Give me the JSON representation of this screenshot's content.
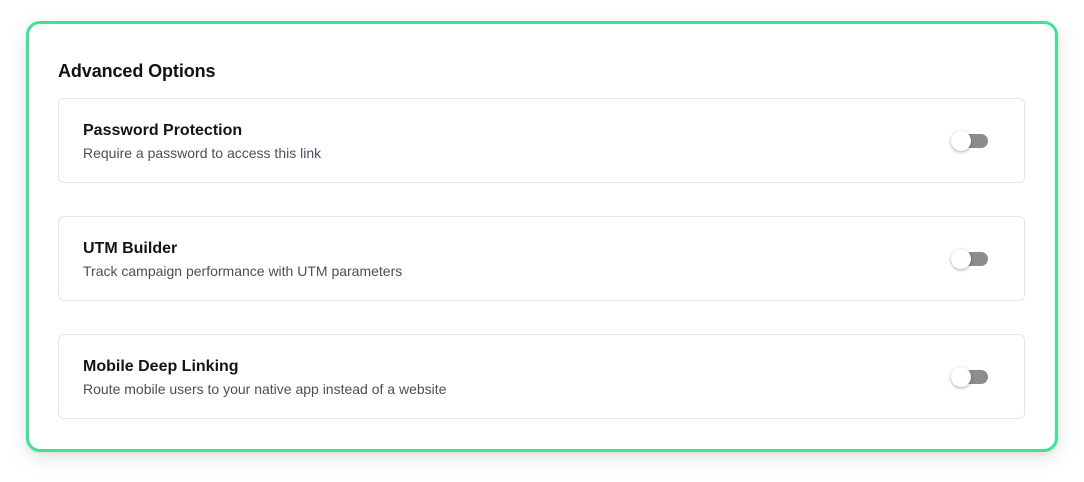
{
  "panel": {
    "title": "Advanced Options",
    "accent_color": "#3ee39a"
  },
  "options": [
    {
      "title": "Password Protection",
      "description": "Require a password to access this link",
      "enabled": false
    },
    {
      "title": "UTM Builder",
      "description": "Track campaign performance with UTM parameters",
      "enabled": false
    },
    {
      "title": "Mobile Deep Linking",
      "description": "Route mobile users to your native app instead of a website",
      "enabled": false
    }
  ]
}
